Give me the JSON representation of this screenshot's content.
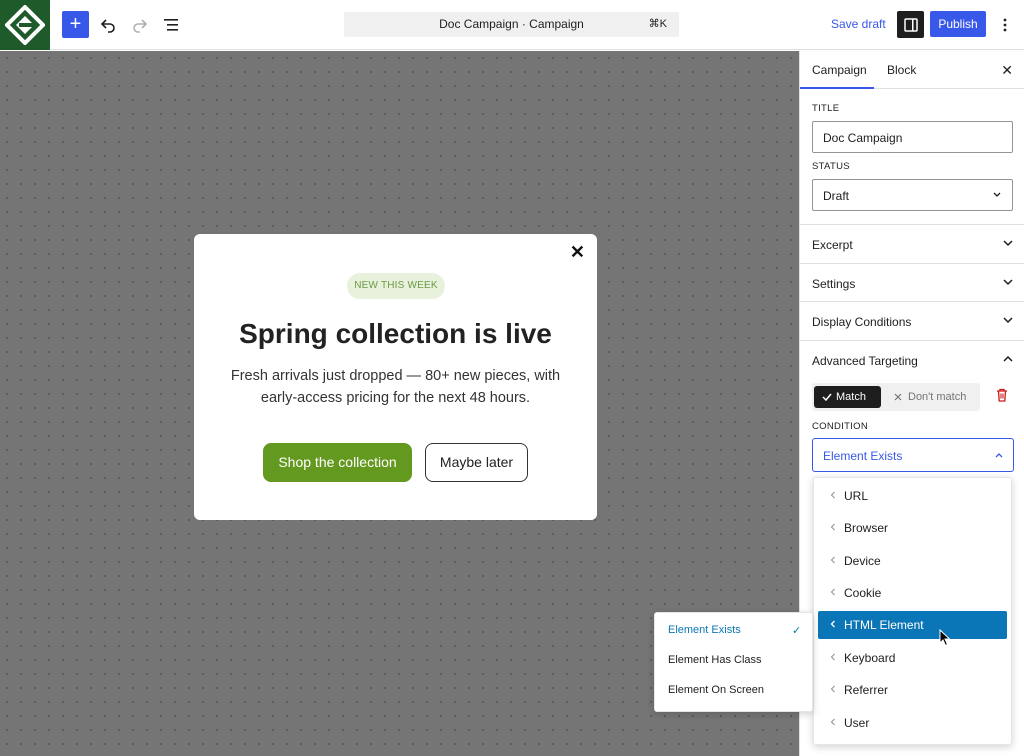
{
  "header": {
    "add_label": "+",
    "command_title": "Doc Campaign · Campaign",
    "command_shortcut": "⌘K",
    "save_draft": "Save draft",
    "publish": "Publish",
    "icons": [
      "logo-icon",
      "undo-icon",
      "redo-icon",
      "list-view-icon",
      "sidebar-toggle-icon",
      "more-options-icon"
    ]
  },
  "popup": {
    "badge": "NEW THIS WEEK",
    "title": "Spring collection is live",
    "text": "Fresh arrivals just dropped — 80+ new pieces, with early-access pricing for the next 48 hours.",
    "primary": "Shop the collection",
    "secondary": "Maybe later",
    "close": "✕",
    "colors": {
      "primary_bg": "#64991f",
      "badge_bg": "#e8f1dc",
      "badge_text": "#6a9b44"
    }
  },
  "sidebar": {
    "tabs": [
      {
        "label": "Campaign"
      },
      {
        "label": "Block"
      }
    ],
    "close": "✕",
    "title_label": "TITLE",
    "title_value": "Doc Campaign",
    "status_label": "STATUS",
    "status_value": "Draft",
    "panels": [
      {
        "label": "Excerpt"
      },
      {
        "label": "Settings"
      },
      {
        "label": "Display Conditions"
      },
      {
        "label": "Advanced Targeting"
      }
    ],
    "match_label": "Match",
    "dont_match_label": "Don't match",
    "condition_label": "CONDITION",
    "condition_value": "Element Exists"
  },
  "menu": {
    "items": [
      {
        "label": "URL"
      },
      {
        "label": "Browser"
      },
      {
        "label": "Device"
      },
      {
        "label": "Cookie"
      },
      {
        "label": "HTML Element"
      },
      {
        "label": "Keyboard"
      },
      {
        "label": "Referrer"
      },
      {
        "label": "User"
      }
    ],
    "active_item": "HTML Element"
  },
  "submenu": {
    "items": [
      {
        "label": "Element Exists"
      },
      {
        "label": "Element Has Class"
      },
      {
        "label": "Element On Screen"
      }
    ],
    "selected_item": "Element Exists"
  },
  "colors": {
    "accent": "#3858e9",
    "menu_active": "#0b76b7",
    "canvas": "#757575",
    "logo_bg": "#1f5a2a"
  }
}
